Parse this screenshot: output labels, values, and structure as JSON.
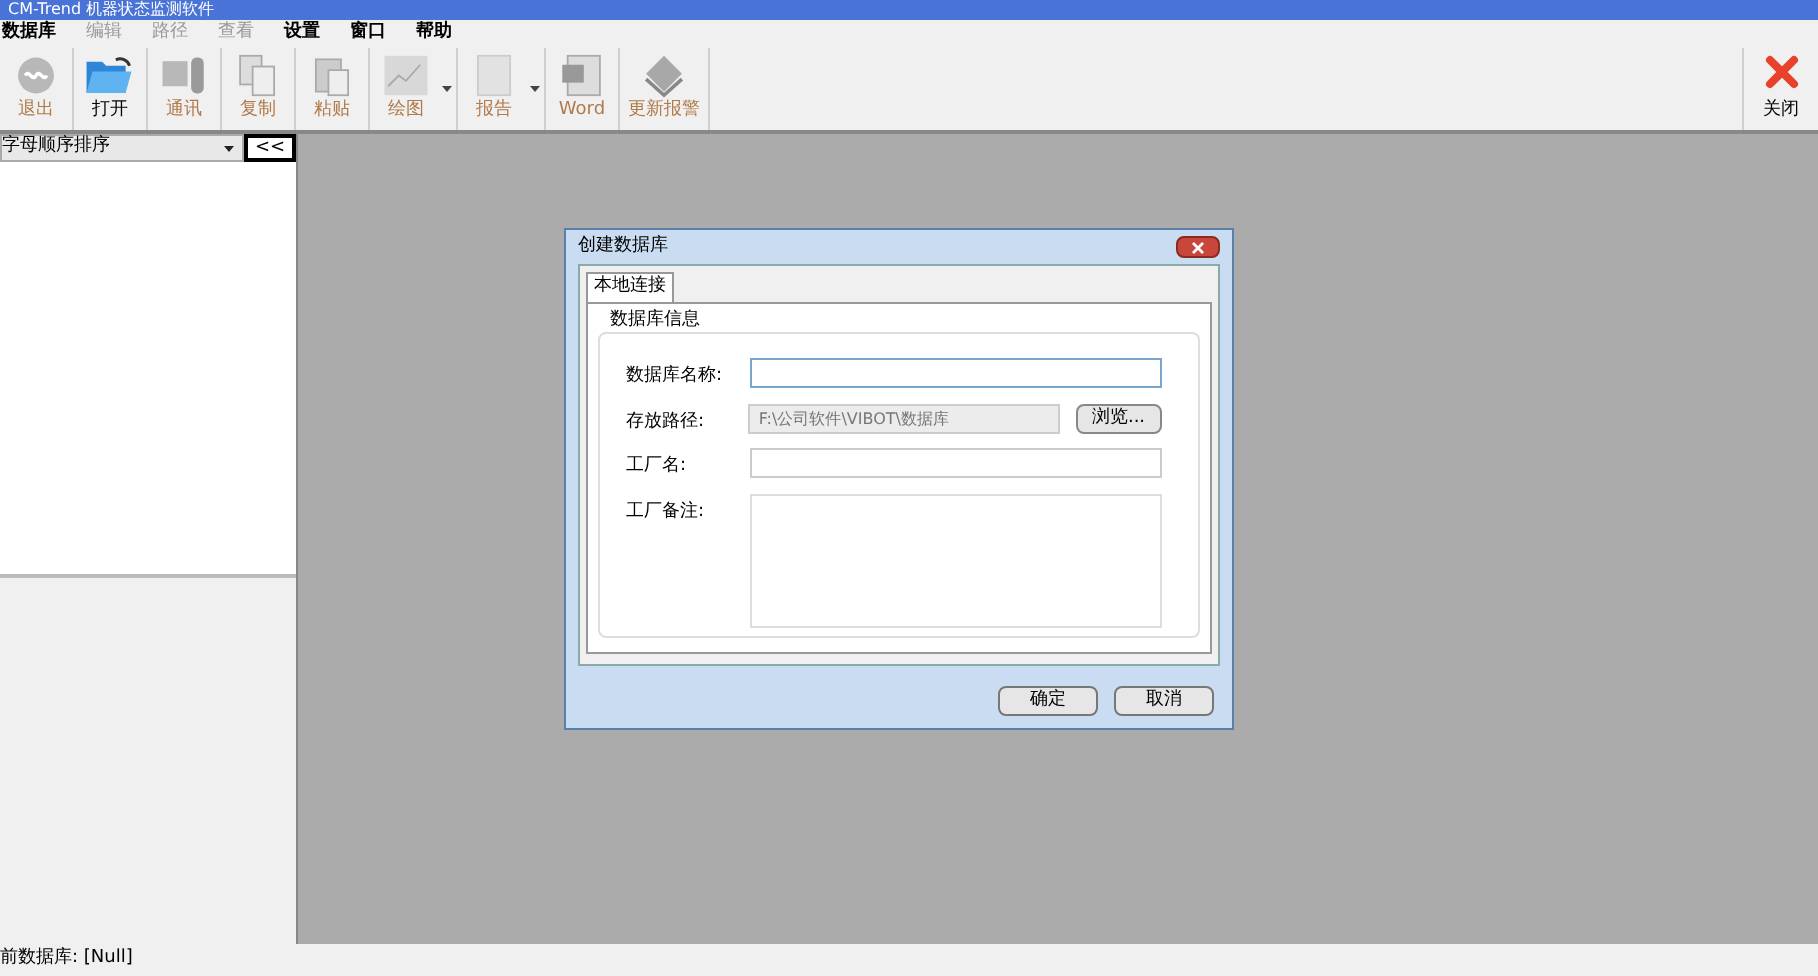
{
  "window": {
    "title": "CM-Trend 机器状态监测软件"
  },
  "menu": [
    {
      "label": "数据库",
      "disabled": false
    },
    {
      "label": "编辑",
      "disabled": true
    },
    {
      "label": "路径",
      "disabled": true
    },
    {
      "label": "查看",
      "disabled": true
    },
    {
      "label": "设置",
      "disabled": false
    },
    {
      "label": "窗口",
      "disabled": false
    },
    {
      "label": "帮助",
      "disabled": false
    }
  ],
  "toolbar": [
    {
      "kind": "exit",
      "label": "退出",
      "disabled": true,
      "dropdown": false
    },
    {
      "kind": "open",
      "label": "打开",
      "disabled": false,
      "dropdown": false
    },
    {
      "kind": "comm",
      "label": "通讯",
      "disabled": true,
      "dropdown": false
    },
    {
      "kind": "copy",
      "label": "复制",
      "disabled": true,
      "dropdown": false
    },
    {
      "kind": "paste",
      "label": "粘贴",
      "disabled": true,
      "dropdown": false
    },
    {
      "kind": "plot",
      "label": "绘图",
      "disabled": true,
      "dropdown": true
    },
    {
      "kind": "report",
      "label": "报告",
      "disabled": true,
      "dropdown": true
    },
    {
      "kind": "word",
      "label": "Word",
      "disabled": true,
      "dropdown": false
    },
    {
      "kind": "alarm",
      "label": "更新报警",
      "disabled": true,
      "dropdown": false
    }
  ],
  "close_button": {
    "label": "关闭"
  },
  "sidebar": {
    "sort_select": "字母顺序排序",
    "collapse_button": "<<"
  },
  "dialog": {
    "title": "创建数据库",
    "tabs": [
      {
        "label": "本地连接",
        "selected": true
      }
    ],
    "group": "数据库信息",
    "fields": [
      {
        "kind": "text",
        "label": "数据库名称:"
      },
      {
        "kind": "path",
        "label": "存放路径:",
        "value": "F:\\公司软件\\VIBOT\\数据库",
        "button": "浏览..."
      },
      {
        "kind": "text",
        "label": "工厂名:"
      },
      {
        "kind": "multiline",
        "label": "工厂备注:"
      }
    ],
    "buttons": [
      "确定",
      "取消"
    ]
  },
  "status_bar": "前数据库: [Null]"
}
